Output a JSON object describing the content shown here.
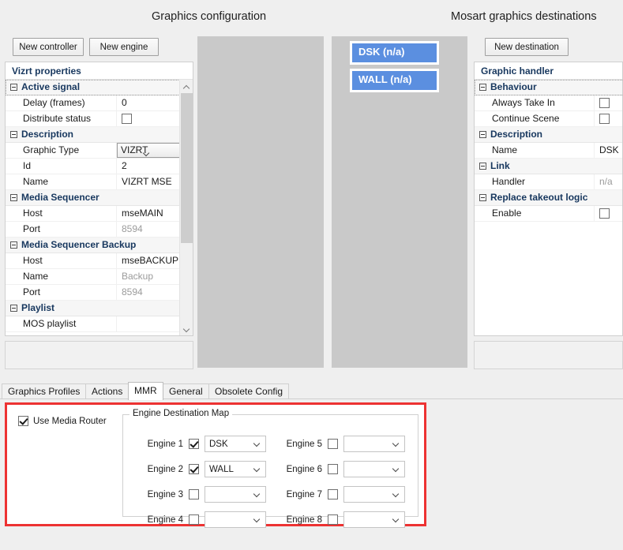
{
  "titles": {
    "left": "Graphics configuration",
    "right": "Mosart graphics destinations"
  },
  "toolbar": {
    "new_controller": "New controller",
    "new_engine": "New engine",
    "new_destination": "New destination"
  },
  "left_panel": {
    "header": "Vizrt properties",
    "rows": [
      {
        "kind": "category",
        "label": "Active signal",
        "focused": true
      },
      {
        "kind": "prop",
        "name": "Delay (frames)",
        "value": "0",
        "type": "text"
      },
      {
        "kind": "prop",
        "name": "Distribute status",
        "value": "",
        "type": "checkbox",
        "checked": false
      },
      {
        "kind": "category",
        "label": "Description"
      },
      {
        "kind": "prop",
        "name": "Graphic Type",
        "value": "VIZRT",
        "type": "combo"
      },
      {
        "kind": "prop",
        "name": "Id",
        "value": "2",
        "type": "text"
      },
      {
        "kind": "prop",
        "name": "Name",
        "value": "VIZRT MSE",
        "type": "text"
      },
      {
        "kind": "category",
        "label": "Media Sequencer"
      },
      {
        "kind": "prop",
        "name": "Host",
        "value": "mseMAIN",
        "type": "text"
      },
      {
        "kind": "prop",
        "name": "Port",
        "value": "8594",
        "type": "text",
        "muted": true
      },
      {
        "kind": "category",
        "label": "Media Sequencer Backup"
      },
      {
        "kind": "prop",
        "name": "Host",
        "value": "mseBACKUP",
        "type": "text"
      },
      {
        "kind": "prop",
        "name": "Name",
        "value": "Backup",
        "type": "text",
        "muted": true
      },
      {
        "kind": "prop",
        "name": "Port",
        "value": "8594",
        "type": "text",
        "muted": true
      },
      {
        "kind": "category",
        "label": "Playlist"
      },
      {
        "kind": "prop",
        "name": "MOS playlist",
        "value": "",
        "type": "combo-empty"
      }
    ]
  },
  "right_panel": {
    "header": "Graphic handler",
    "rows": [
      {
        "kind": "category",
        "label": "Behaviour",
        "focused": true
      },
      {
        "kind": "prop",
        "name": "Always Take In",
        "value": "",
        "type": "checkbox",
        "checked": false
      },
      {
        "kind": "prop",
        "name": "Continue Scene",
        "value": "",
        "type": "checkbox",
        "checked": false
      },
      {
        "kind": "category",
        "label": "Description"
      },
      {
        "kind": "prop",
        "name": "Name",
        "value": "DSK",
        "type": "text"
      },
      {
        "kind": "category",
        "label": "Link"
      },
      {
        "kind": "prop",
        "name": "Handler",
        "value": "n/a",
        "type": "text",
        "muted": true
      },
      {
        "kind": "category",
        "label": "Replace takeout logic"
      },
      {
        "kind": "prop",
        "name": "Enable",
        "value": "",
        "type": "checkbox",
        "checked": false
      }
    ]
  },
  "destinations": [
    {
      "label": "DSK (n/a)",
      "selected": true
    },
    {
      "label": "WALL (n/a)",
      "selected": false
    }
  ],
  "tabs": [
    {
      "label": "Graphics Profiles",
      "active": false
    },
    {
      "label": "Actions",
      "active": false
    },
    {
      "label": "MMR",
      "active": true
    },
    {
      "label": "General",
      "active": false
    },
    {
      "label": "Obsolete Config",
      "active": false
    }
  ],
  "mmr": {
    "use_media_router_label": "Use Media Router",
    "use_media_router_checked": true,
    "groupbox_title": "Engine Destination Map",
    "engines": [
      {
        "label": "Engine 1",
        "checked": true,
        "destination": "DSK"
      },
      {
        "label": "Engine 2",
        "checked": true,
        "destination": "WALL"
      },
      {
        "label": "Engine 3",
        "checked": false,
        "destination": ""
      },
      {
        "label": "Engine 4",
        "checked": false,
        "destination": ""
      },
      {
        "label": "Engine 5",
        "checked": false,
        "destination": ""
      },
      {
        "label": "Engine 6",
        "checked": false,
        "destination": ""
      },
      {
        "label": "Engine 7",
        "checked": false,
        "destination": ""
      },
      {
        "label": "Engine 8",
        "checked": false,
        "destination": ""
      }
    ]
  },
  "colors": {
    "accent_blue": "#5b8fe0",
    "highlight_red": "#ed3232",
    "category_text": "#17375e",
    "panel_grey": "#c9c9c9",
    "window_bg": "#efefef"
  }
}
